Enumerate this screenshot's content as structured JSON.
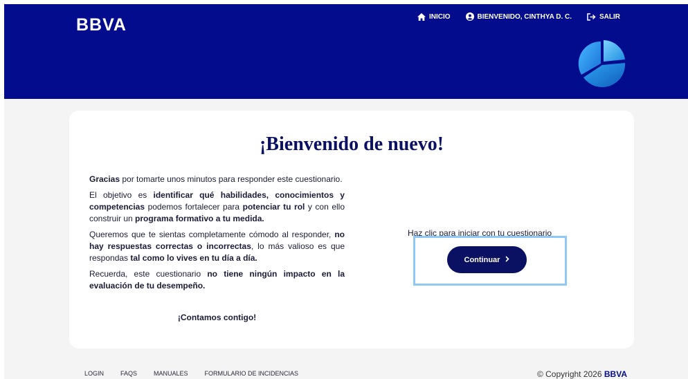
{
  "header": {
    "logo_text": "BBVA",
    "nav": {
      "home_label": "INICIO",
      "user_label": "BIENVENIDO, CINTHYA D. C.",
      "logout_label": "SALIR"
    },
    "bg_color": "#030c8d"
  },
  "card": {
    "title": "¡Bienvenido de nuevo!",
    "p1": {
      "b1": "Gracias",
      "t1": " por tomarte unos minutos para responder este cuestionario."
    },
    "p2": {
      "t1": "El objetivo es ",
      "b1": "identificar qué habilidades, conocimientos y competencias",
      "t2": " podemos fortalecer para ",
      "b2": "potenciar tu rol",
      "t3": " y con ello construir un ",
      "b3": "programa formativo a tu medida."
    },
    "p3": {
      "t1": "Queremos que te sientas completamente cómodo al responder, ",
      "b1": "no hay respuestas correctas o incorrectas",
      "t2": ", lo más valioso es que respondas ",
      "b2": "tal como lo vives en tu día a día."
    },
    "p4": {
      "t1": "Recuerda, este cuestionario ",
      "b1": "no tiene ningún impacto en la evaluación de tu desempeño."
    },
    "closing": "¡Contamos contigo!",
    "cta_hint": "Haz clic para iniciar con tu cuestionario",
    "continue_label": "Continuar"
  },
  "footer": {
    "links": [
      "LOGIN",
      "FAQS",
      "MANUALES",
      "FORMULARIO DE INCIDENCIAS"
    ],
    "copyright_prefix": "© Copyright 2026 ",
    "copyright_brand": "BBVA"
  },
  "icons": {
    "home": "home-icon",
    "user": "user-circle-icon",
    "logout": "logout-icon",
    "chevron": "chevron-right-icon",
    "brand_pie": "pie-chart-icon"
  },
  "colors": {
    "navy": "#0a1062",
    "highlight": "#8fc7f5"
  }
}
